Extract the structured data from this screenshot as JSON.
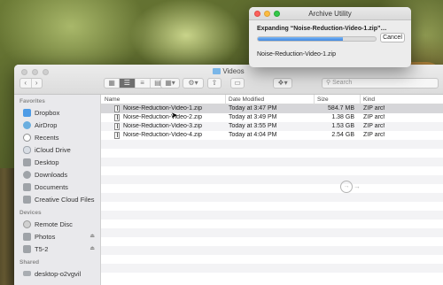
{
  "finder": {
    "title": "Videos",
    "search_placeholder": "Search",
    "view_modes": [
      "▦",
      "☰",
      "≡",
      "▤"
    ],
    "sidebar": {
      "favorites_header": "Favorites",
      "favorites": [
        {
          "label": "Dropbox",
          "icon": "dropbox-icon"
        },
        {
          "label": "AirDrop",
          "icon": "airdrop-icon"
        },
        {
          "label": "Recents",
          "icon": "clock-icon"
        },
        {
          "label": "iCloud Drive",
          "icon": "cloud-icon"
        },
        {
          "label": "Desktop",
          "icon": "desktop-icon"
        },
        {
          "label": "Downloads",
          "icon": "downloads-icon"
        },
        {
          "label": "Documents",
          "icon": "documents-icon"
        },
        {
          "label": "Creative Cloud Files",
          "icon": "creative-cloud-icon"
        }
      ],
      "devices_header": "Devices",
      "devices": [
        {
          "label": "Remote Disc",
          "icon": "disc-icon"
        },
        {
          "label": "Photos",
          "icon": "drive-icon",
          "eject": "⏏"
        },
        {
          "label": "T5-2",
          "icon": "drive-icon",
          "eject": "⏏"
        }
      ],
      "shared_header": "Shared",
      "shared": [
        {
          "label": "desktop-o2vgvil",
          "icon": "laptop-icon"
        }
      ]
    },
    "columns": {
      "name": "Name",
      "date": "Date Modified",
      "size": "Size",
      "kind": "Kind"
    },
    "files": [
      {
        "name": "Noise-Reduction-Video-1.zip",
        "date": "Today at 3:47 PM",
        "size": "584.7 MB",
        "kind": "ZIP archive"
      },
      {
        "name": "Noise-Reduction-Video-2.zip",
        "date": "Today at 3:49 PM",
        "size": "1.38 GB",
        "kind": "ZIP archive"
      },
      {
        "name": "Noise-Reduction-Video-3.zip",
        "date": "Today at 3:55 PM",
        "size": "1.53 GB",
        "kind": "ZIP archive"
      },
      {
        "name": "Noise-Reduction-Video-4.zip",
        "date": "Today at 4:04 PM",
        "size": "2.54 GB",
        "kind": "ZIP archive"
      }
    ]
  },
  "archive_utility": {
    "title": "Archive Utility",
    "status": "Expanding “Noise-Reduction-Video-1.zip”…",
    "progress": 0.72,
    "cancel_label": "Cancel",
    "current_file": "Noise-Reduction-Video-1.zip"
  }
}
